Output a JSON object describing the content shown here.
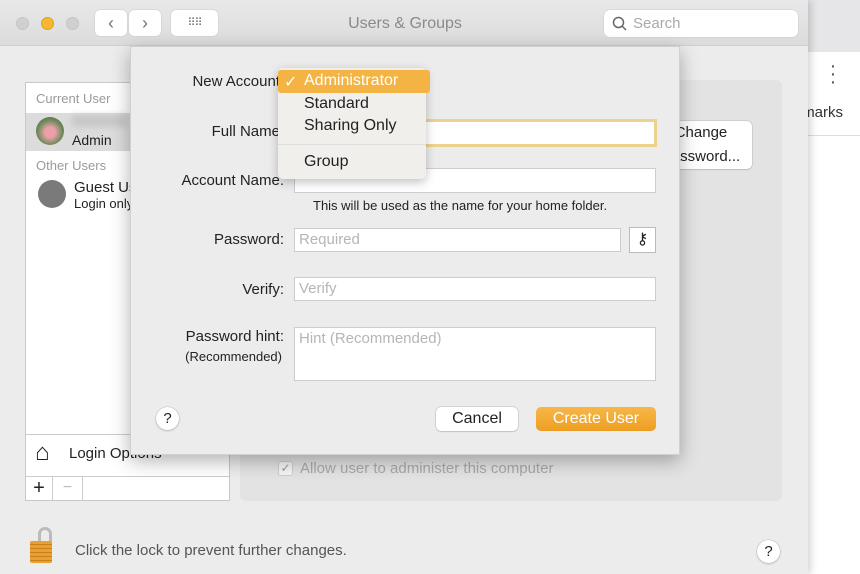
{
  "window": {
    "title": "Users & Groups",
    "search_placeholder": "Search"
  },
  "browser": {
    "text": "Bookmarks",
    "menu_icon": "kebab-icon"
  },
  "sidebar": {
    "current_user_header": "Current User",
    "current_user_role": "Admin",
    "other_users_header": "Other Users",
    "guest_name": "Guest User",
    "guest_sub": "Login only",
    "login_options": "Login Options",
    "add": "+",
    "remove": "−"
  },
  "pane": {
    "change_password": "Change Password...",
    "allow_admin": "Allow user to administer this computer",
    "allow_admin_checked": true
  },
  "footer": {
    "lock_text": "Click the lock to prevent further changes.",
    "help": "?"
  },
  "sheet": {
    "new_account_label": "New Account",
    "full_name_label": "Full Name",
    "account_name_label": "Account Name:",
    "account_name_note": "This will be used as the name for your home folder.",
    "password_label": "Password:",
    "password_placeholder": "Required",
    "verify_label": "Verify:",
    "verify_placeholder": "Verify",
    "hint_label": "Password hint:",
    "hint_sub": "(Recommended)",
    "hint_placeholder": "Hint (Recommended)",
    "help": "?",
    "cancel": "Cancel",
    "create": "Create User",
    "accent": "#f0a330"
  },
  "menu": {
    "items": [
      "Administrator",
      "Standard",
      "Sharing Only",
      "Group"
    ],
    "selected": "Administrator",
    "check": "✓"
  }
}
